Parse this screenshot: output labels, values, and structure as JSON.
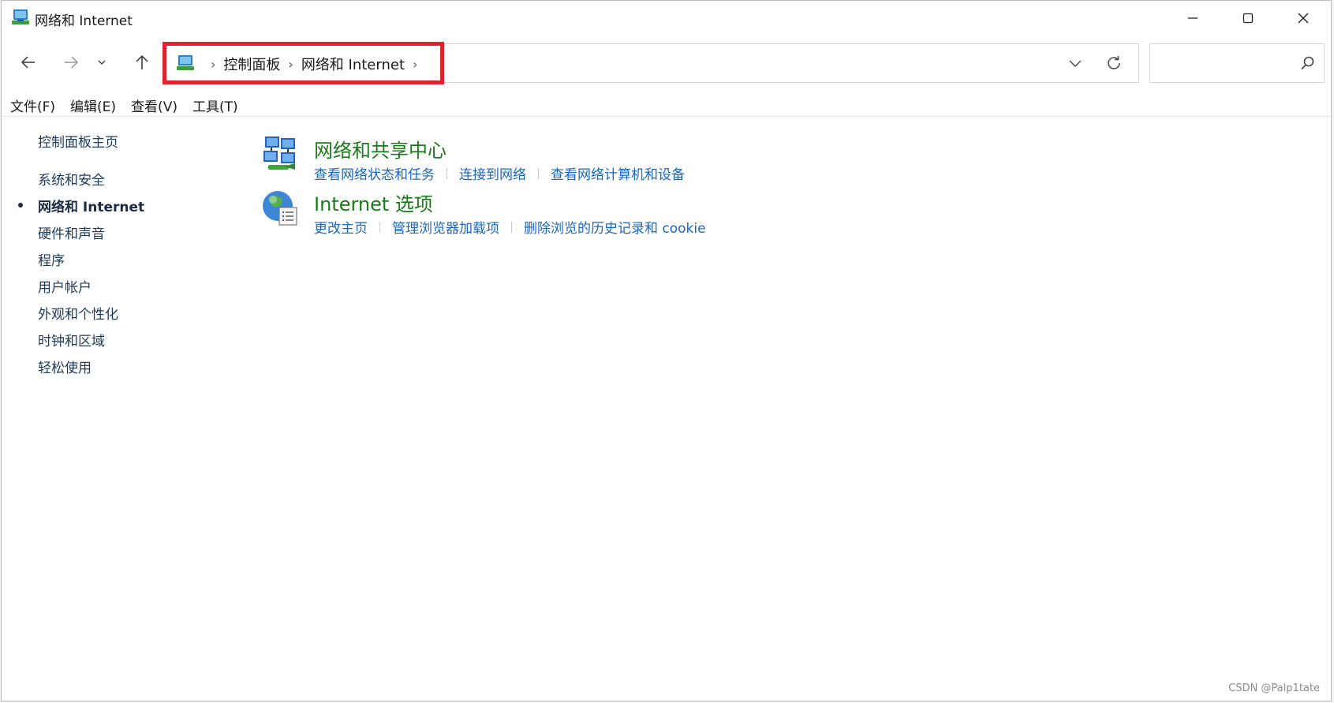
{
  "window": {
    "title": "网络和 Internet"
  },
  "address": {
    "crumbs": [
      "控制面板",
      "网络和 Internet"
    ],
    "separator": "›"
  },
  "search": {
    "placeholder": ""
  },
  "menu": {
    "items": [
      "文件(F)",
      "编辑(E)",
      "查看(V)",
      "工具(T)"
    ]
  },
  "sidebar": {
    "items": [
      {
        "label": "控制面板主页",
        "active": false
      },
      {
        "label": "系统和安全",
        "active": false
      },
      {
        "label": "网络和 Internet",
        "active": true
      },
      {
        "label": "硬件和声音",
        "active": false
      },
      {
        "label": "程序",
        "active": false
      },
      {
        "label": "用户帐户",
        "active": false
      },
      {
        "label": "外观和个性化",
        "active": false
      },
      {
        "label": "时钟和区域",
        "active": false
      },
      {
        "label": "轻松使用",
        "active": false
      }
    ]
  },
  "categories": [
    {
      "title": "网络和共享中心",
      "icon": "network-sharing-center-icon",
      "links": [
        "查看网络状态和任务",
        "连接到网络",
        "查看网络计算机和设备"
      ]
    },
    {
      "title": "Internet 选项",
      "icon": "internet-options-icon",
      "links": [
        "更改主页",
        "管理浏览器加载项",
        "删除浏览的历史记录和 cookie"
      ]
    }
  ],
  "watermark": "CSDN @Palp1tate",
  "colors": {
    "category_title": "#1c7a1c",
    "link": "#1a66c2",
    "highlight_box": "#e5202c"
  }
}
